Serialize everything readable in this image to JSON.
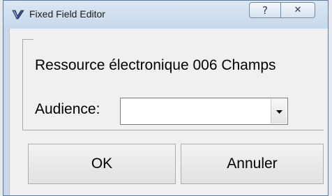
{
  "window": {
    "title": "Fixed Field Editor",
    "help_glyph": "?",
    "close_glyph": "✕"
  },
  "icons": {
    "app": "checkmark-v-icon",
    "help": "help-icon",
    "close": "close-icon",
    "dropdown": "chevron-down-icon"
  },
  "group": {
    "legend": "Ressource électronique 006 Champs"
  },
  "audience": {
    "label": "Audience:",
    "value": ""
  },
  "buttons": {
    "ok": "OK",
    "cancel": "Annuler"
  },
  "colors": {
    "titlebar": "#c9d9ea",
    "client": "#f0f0f0",
    "border": "#5f7a96"
  }
}
